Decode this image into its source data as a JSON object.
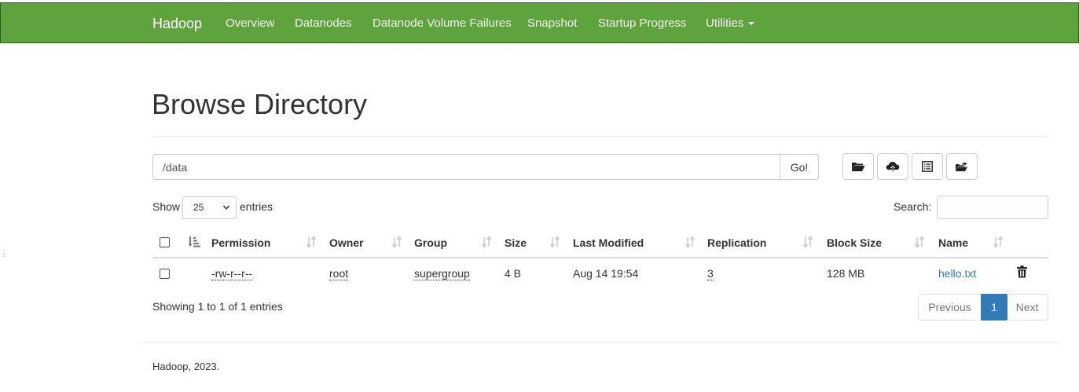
{
  "navbar": {
    "brand": "Hadoop",
    "items": [
      "Overview",
      "Datanodes",
      "Datanode Volume Failures",
      "Snapshot",
      "Startup Progress",
      "Utilities"
    ],
    "color": "#5fa33e"
  },
  "page": {
    "title": "Browse Directory"
  },
  "path": {
    "value": "/data",
    "go_label": "Go!"
  },
  "toolbar": {
    "icons": [
      "folder-open-icon",
      "cloud-upload-icon",
      "list-icon",
      "folder-move-icon"
    ]
  },
  "table_controls": {
    "show_label": "Show",
    "entries_value": "25",
    "entries_label": "entries",
    "search_label": "Search:"
  },
  "table": {
    "columns": [
      "Permission",
      "Owner",
      "Group",
      "Size",
      "Last Modified",
      "Replication",
      "Block Size",
      "Name"
    ],
    "rows": [
      {
        "permission": "-rw-r--r--",
        "owner": "root",
        "group": "supergroup",
        "size": "4 B",
        "last_modified": "Aug 14 19:54",
        "replication": "3",
        "block_size": "128 MB",
        "name": "hello.txt"
      }
    ]
  },
  "info": "Showing 1 to 1 of 1 entries",
  "pagination": {
    "previous": "Previous",
    "current": "1",
    "next": "Next"
  },
  "footer": "Hadoop, 2023.",
  "colors": {
    "link": "#337ab7",
    "active_page": "#337ab7"
  }
}
